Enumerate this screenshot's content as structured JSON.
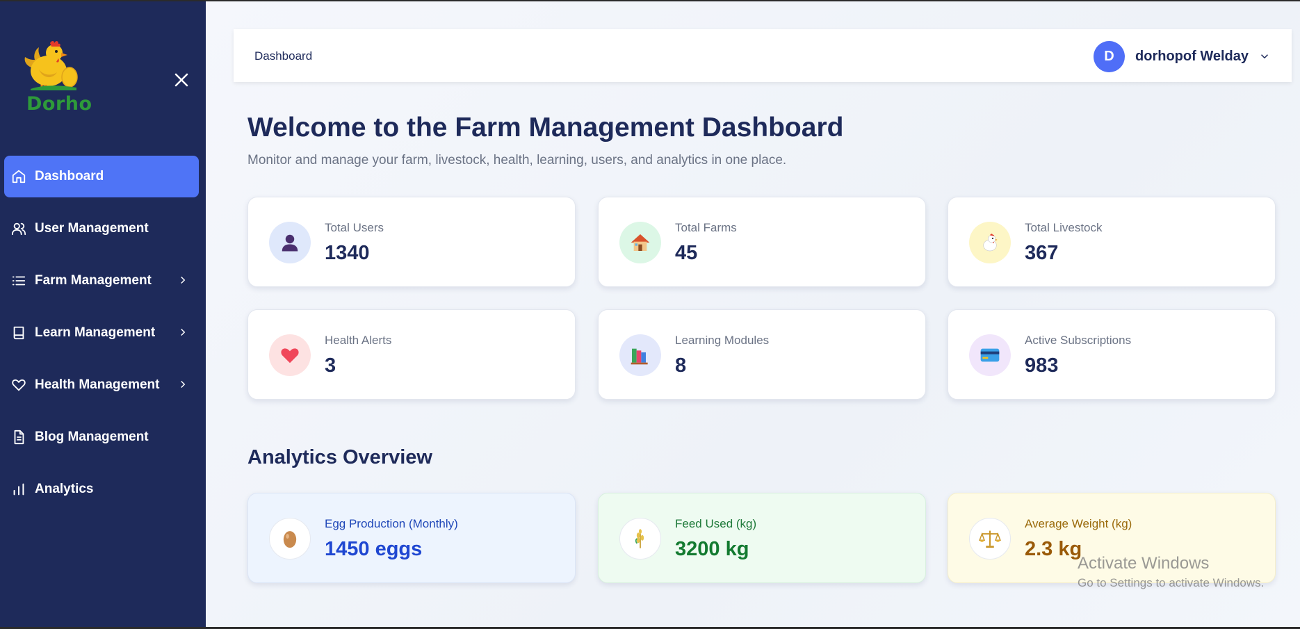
{
  "brand": {
    "name": "Dorho"
  },
  "sidebar": {
    "items": [
      {
        "label": "Dashboard",
        "icon": "home-icon",
        "active": true,
        "chevron": false
      },
      {
        "label": "User Management",
        "icon": "users-icon",
        "active": false,
        "chevron": false
      },
      {
        "label": "Farm Management",
        "icon": "list-icon",
        "active": false,
        "chevron": true
      },
      {
        "label": "Learn Management",
        "icon": "book-icon",
        "active": false,
        "chevron": true
      },
      {
        "label": "Health Management",
        "icon": "heart-icon",
        "active": false,
        "chevron": true
      },
      {
        "label": "Blog Management",
        "icon": "document-icon",
        "active": false,
        "chevron": false
      },
      {
        "label": "Analytics",
        "icon": "bar-chart-icon",
        "active": false,
        "chevron": false
      }
    ]
  },
  "header": {
    "breadcrumb": "Dashboard",
    "user": {
      "initial": "D",
      "name": "dorhopof Welday"
    }
  },
  "main": {
    "title": "Welcome to the Farm Management Dashboard",
    "subtitle": "Monitor and manage your farm, livestock, health, learning, users, and analytics in one place.",
    "stats": [
      {
        "label": "Total Users",
        "value": "1340",
        "icon": "user-icon",
        "glyph": "👤",
        "bg": "#dfe8fb"
      },
      {
        "label": "Total Farms",
        "value": "45",
        "icon": "house-icon",
        "glyph": "🏠",
        "bg": "#dcf7e6"
      },
      {
        "label": "Total Livestock",
        "value": "367",
        "icon": "chicken-icon",
        "glyph": "🐔",
        "bg": "#fdf6c6"
      },
      {
        "label": "Health Alerts",
        "value": "3",
        "icon": "heart-icon",
        "glyph": "❤",
        "bg": "#fde2e2"
      },
      {
        "label": "Learning Modules",
        "value": "8",
        "icon": "books-icon",
        "glyph": "📚",
        "bg": "#e3e8fb"
      },
      {
        "label": "Active Subscriptions",
        "value": "983",
        "icon": "credit-card-icon",
        "glyph": "💳",
        "bg": "#f1e6fb"
      }
    ],
    "analytics_title": "Analytics Overview",
    "analytics": [
      {
        "label": "Egg Production (Monthly)",
        "value": "1450 eggs",
        "icon": "egg-icon",
        "glyph": "🥚",
        "bg": "#edf4fe",
        "border": "#dbe5f6",
        "labelColor": "#1f47b8",
        "valueColor": "#1f47d1"
      },
      {
        "label": "Feed Used (kg)",
        "value": "3200 kg",
        "icon": "wheat-icon",
        "glyph": "🌾",
        "bg": "#eefbf1",
        "border": "#d8f0df",
        "labelColor": "#1f7a3a",
        "valueColor": "#137a30"
      },
      {
        "label": "Average Weight (kg)",
        "value": "2.3 kg",
        "icon": "scale-icon",
        "glyph": "⚖",
        "bg": "#fefbe6",
        "border": "#f5efcb",
        "labelColor": "#9a6a0b",
        "valueColor": "#9a5a08"
      }
    ]
  },
  "watermark": {
    "line1": "Activate Windows",
    "line2": "Go to Settings to activate Windows."
  }
}
